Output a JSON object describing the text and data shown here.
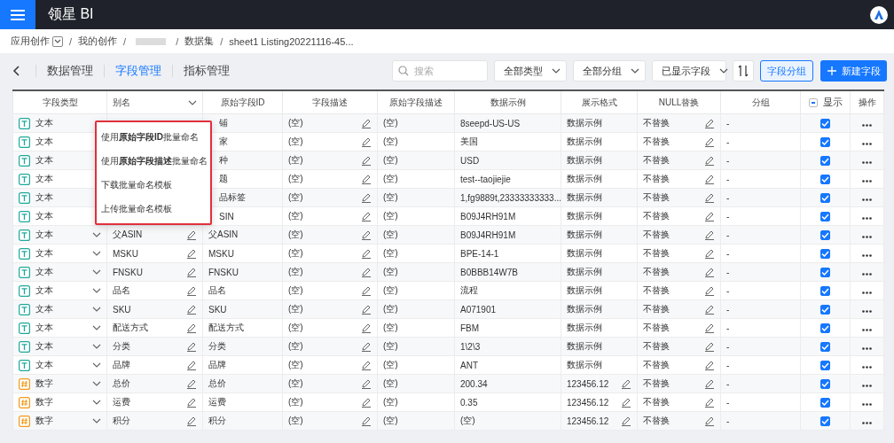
{
  "app": {
    "title": "领星 BI"
  },
  "breadcrumb": [
    {
      "kind": "link",
      "label": "应用创作",
      "dropdown": true
    },
    {
      "kind": "link",
      "separator": "/",
      "label": "我的创作",
      "dropdown": false
    },
    {
      "kind": "redacted",
      "separator": "/"
    },
    {
      "kind": "link",
      "separator": "/",
      "label": "数据集",
      "dropdown": false
    },
    {
      "kind": "link",
      "separator": "/",
      "label": "sheet1 Listing20221116-45...",
      "dropdown": false
    }
  ],
  "tabs": [
    {
      "label": "数据管理",
      "selected": false
    },
    {
      "label": "字段管理",
      "selected": true
    },
    {
      "label": "指标管理",
      "selected": false
    }
  ],
  "search": {
    "placeholder": "搜索"
  },
  "filters": [
    "全部类型",
    "全部分组",
    "已显示字段"
  ],
  "buttons": {
    "group": "字段分组",
    "create": "新建字段"
  },
  "table": {
    "columns": [
      "字段类型",
      "别名",
      "原始字段ID",
      "字段描述",
      "原始字段描述",
      "数据示例",
      "展示格式",
      "NULL替换",
      "分组",
      "显示",
      "操作"
    ],
    "display_indeterminate": true,
    "rows": [
      {
        "kind": "text",
        "type": "文本",
        "dropdown": false,
        "id": "铺",
        "desc": "(空)",
        "orig_desc": "(空)",
        "sample": "8seepd-US-US",
        "format": "数据示例",
        "format_editable": false,
        "null": "不替换",
        "group": "-",
        "shown": true
      },
      {
        "kind": "text",
        "type": "文本",
        "dropdown": false,
        "id": "家",
        "desc": "(空)",
        "orig_desc": "(空)",
        "sample": "美国",
        "format": "数据示例",
        "format_editable": false,
        "null": "不替换",
        "group": "-",
        "shown": true
      },
      {
        "kind": "text",
        "type": "文本",
        "dropdown": false,
        "id": "种",
        "desc": "(空)",
        "orig_desc": "(空)",
        "sample": "USD",
        "format": "数据示例",
        "format_editable": false,
        "null": "不替换",
        "group": "-",
        "shown": true
      },
      {
        "kind": "text",
        "type": "文本",
        "dropdown": false,
        "id": "题",
        "desc": "(空)",
        "orig_desc": "(空)",
        "sample": "test--taojiejie",
        "format": "数据示例",
        "format_editable": false,
        "null": "不替换",
        "group": "-",
        "shown": true
      },
      {
        "kind": "text",
        "type": "文本",
        "dropdown": false,
        "id": "品标签",
        "desc": "(空)",
        "orig_desc": "(空)",
        "sample": "1,fg9889t,23333333333...",
        "format": "数据示例",
        "format_editable": false,
        "null": "不替换",
        "group": "-",
        "shown": true
      },
      {
        "kind": "text",
        "type": "文本",
        "dropdown": false,
        "id": "SIN",
        "desc": "(空)",
        "orig_desc": "(空)",
        "sample": "B09J4RH91M",
        "format": "数据示例",
        "format_editable": false,
        "null": "不替换",
        "group": "-",
        "shown": true
      },
      {
        "kind": "text",
        "type": "文本",
        "dropdown": true,
        "alias": "父ASIN",
        "id": "父ASIN",
        "desc": "(空)",
        "orig_desc": "(空)",
        "sample": "B09J4RH91M",
        "format": "数据示例",
        "format_editable": false,
        "null": "不替换",
        "group": "-",
        "shown": true
      },
      {
        "kind": "text",
        "type": "文本",
        "dropdown": true,
        "alias": "MSKU",
        "id": "MSKU",
        "desc": "(空)",
        "orig_desc": "(空)",
        "sample": "BPE-14-1",
        "format": "数据示例",
        "format_editable": false,
        "null": "不替换",
        "group": "-",
        "shown": true
      },
      {
        "kind": "text",
        "type": "文本",
        "dropdown": true,
        "alias": "FNSKU",
        "id": "FNSKU",
        "desc": "(空)",
        "orig_desc": "(空)",
        "sample": "B0BBB14W7B",
        "format": "数据示例",
        "format_editable": false,
        "null": "不替换",
        "group": "-",
        "shown": true
      },
      {
        "kind": "text",
        "type": "文本",
        "dropdown": true,
        "alias": "品名",
        "id": "品名",
        "desc": "(空)",
        "orig_desc": "(空)",
        "sample": "流程",
        "format": "数据示例",
        "format_editable": false,
        "null": "不替换",
        "group": "-",
        "shown": true
      },
      {
        "kind": "text",
        "type": "文本",
        "dropdown": true,
        "alias": "SKU",
        "id": "SKU",
        "desc": "(空)",
        "orig_desc": "(空)",
        "sample": "A071901",
        "format": "数据示例",
        "format_editable": false,
        "null": "不替换",
        "group": "-",
        "shown": true
      },
      {
        "kind": "text",
        "type": "文本",
        "dropdown": true,
        "alias": "配送方式",
        "id": "配送方式",
        "desc": "(空)",
        "orig_desc": "(空)",
        "sample": "FBM",
        "format": "数据示例",
        "format_editable": false,
        "null": "不替换",
        "group": "-",
        "shown": true
      },
      {
        "kind": "text",
        "type": "文本",
        "dropdown": true,
        "alias": "分类",
        "id": "分类",
        "desc": "(空)",
        "orig_desc": "(空)",
        "sample": "1\\2\\3",
        "format": "数据示例",
        "format_editable": false,
        "null": "不替换",
        "group": "-",
        "shown": true
      },
      {
        "kind": "text",
        "type": "文本",
        "dropdown": true,
        "alias": "品牌",
        "id": "品牌",
        "desc": "(空)",
        "orig_desc": "(空)",
        "sample": "ANT",
        "format": "数据示例",
        "format_editable": false,
        "null": "不替换",
        "group": "-",
        "shown": true
      },
      {
        "kind": "number",
        "type": "数字",
        "dropdown": true,
        "alias": "总价",
        "id": "总价",
        "desc": "(空)",
        "orig_desc": "(空)",
        "sample": "200.34",
        "format": "123456.12",
        "format_editable": true,
        "null": "不替换",
        "group": "-",
        "shown": true
      },
      {
        "kind": "number",
        "type": "数字",
        "dropdown": true,
        "alias": "运费",
        "id": "运费",
        "desc": "(空)",
        "orig_desc": "(空)",
        "sample": "0.35",
        "format": "123456.12",
        "format_editable": true,
        "null": "不替换",
        "group": "-",
        "shown": true
      },
      {
        "kind": "number",
        "type": "数字",
        "dropdown": true,
        "alias": "积分",
        "id": "积分",
        "desc": "(空)",
        "orig_desc": "(空)",
        "sample": "(空)",
        "format": "123456.12",
        "format_editable": true,
        "null": "不替换",
        "group": "-",
        "shown": true
      }
    ]
  },
  "alias_menu": {
    "items": [
      "使用**原始字段ID**批量命名",
      "使用**原始字段描述**批量命名",
      "下载批量命名模板",
      "上传批量命名模板"
    ]
  }
}
